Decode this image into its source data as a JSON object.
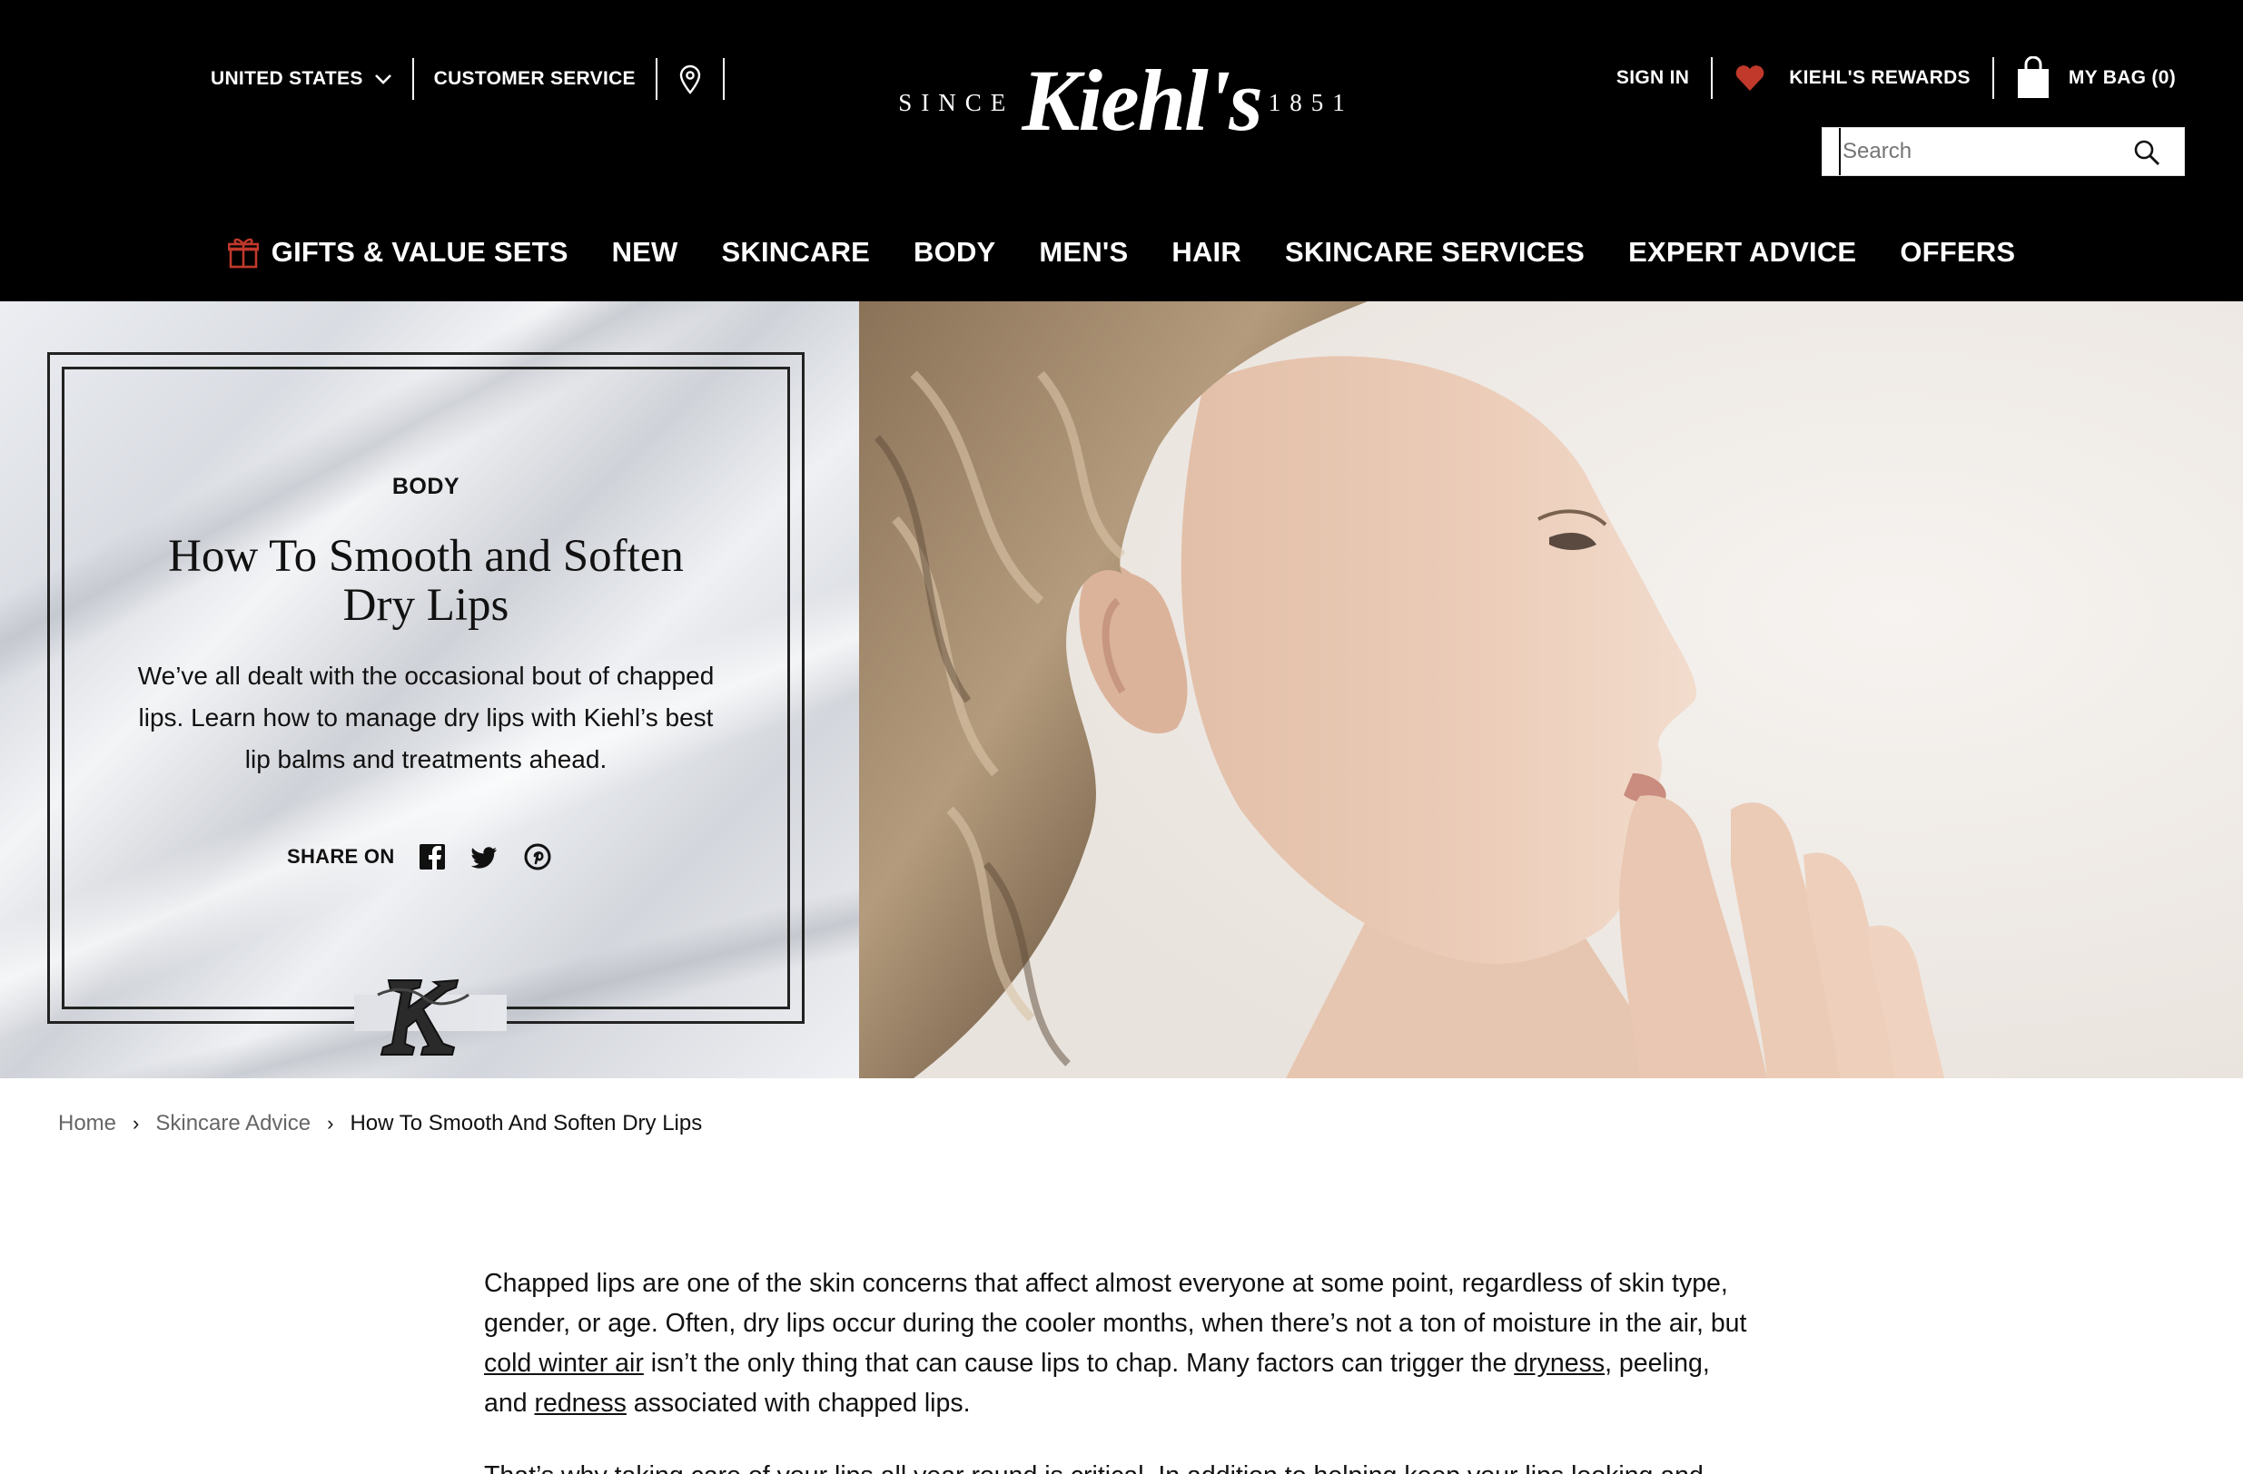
{
  "header": {
    "country": "UNITED STATES",
    "customer_service": "CUSTOMER SERVICE",
    "logo": {
      "since": "SINCE",
      "brand": "Kiehl's",
      "year": "1851"
    },
    "sign_in": "SIGN IN",
    "rewards": "KIEHL'S REWARDS",
    "bag": "MY BAG (0)",
    "search": {
      "placeholder": "Search",
      "value": ""
    }
  },
  "nav": {
    "items": [
      {
        "label": "GIFTS & VALUE SETS",
        "icon": "gift-icon"
      },
      {
        "label": "NEW"
      },
      {
        "label": "SKINCARE"
      },
      {
        "label": "BODY"
      },
      {
        "label": "MEN'S"
      },
      {
        "label": "HAIR"
      },
      {
        "label": "SKINCARE SERVICES"
      },
      {
        "label": "EXPERT ADVICE"
      },
      {
        "label": "OFFERS"
      }
    ]
  },
  "hero": {
    "category": "BODY",
    "title_line1": "How To Smooth and Soften",
    "title_line2": "Dry Lips",
    "description": "We’ve all dealt with the occasional bout of chapped lips. Learn how to manage dry lips with Kiehl’s best lip balms and treatments ahead.",
    "share_label": "SHARE ON",
    "share_icons": [
      "facebook-icon",
      "twitter-icon",
      "pinterest-icon"
    ]
  },
  "breadcrumb": {
    "items": [
      "Home",
      "Skincare Advice",
      "How To Smooth And Soften Dry Lips"
    ]
  },
  "article": {
    "p1": {
      "t1": "Chapped lips are one of the skin concerns that affect almost everyone at some point, regardless of skin type, gender, or age. Often, dry lips occur during the cooler months, when there’s not a ton of moisture in the air, but ",
      "link1": "cold winter air",
      "t2": " isn’t the only thing that can cause lips to chap. Many factors can trigger the ",
      "link2": "dryness",
      "t3": ", peeling, and ",
      "link3": "redness",
      "t4": " associated with chapped lips."
    },
    "p2": "That’s why taking care of your lips all year round is critical. In addition to helping keep your lips looking and"
  },
  "colors": {
    "header_bg": "#000000",
    "rewards_heart": "#c0392b",
    "gift_icon": "#c0392b"
  }
}
